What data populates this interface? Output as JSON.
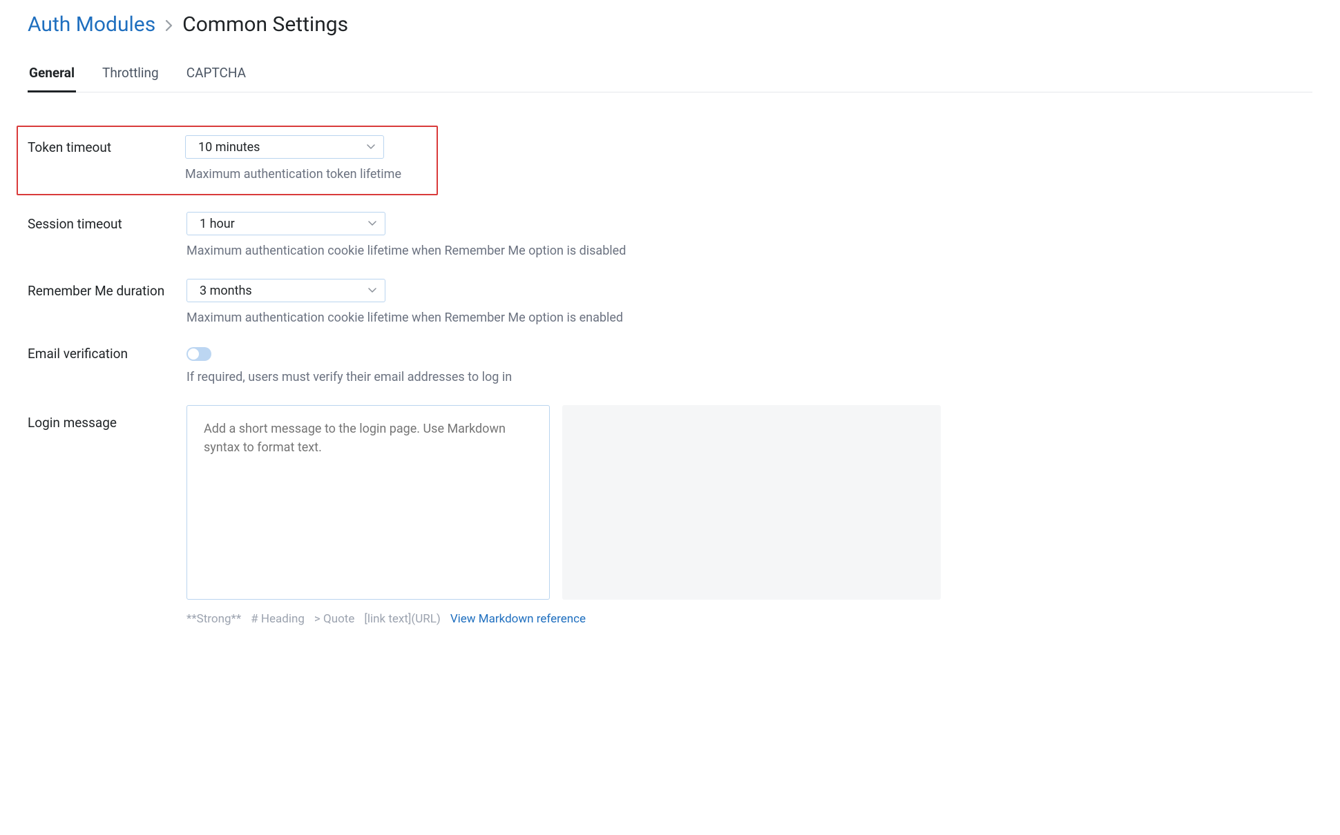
{
  "breadcrumb": {
    "parent": "Auth Modules",
    "current": "Common Settings"
  },
  "tabs": [
    {
      "label": "General",
      "active": true
    },
    {
      "label": "Throttling",
      "active": false
    },
    {
      "label": "CAPTCHA",
      "active": false
    }
  ],
  "token_timeout": {
    "label": "Token timeout",
    "value": "10 minutes",
    "help": "Maximum authentication token lifetime"
  },
  "session_timeout": {
    "label": "Session timeout",
    "value": "1 hour",
    "help": "Maximum authentication cookie lifetime when Remember Me option is disabled"
  },
  "remember_me": {
    "label": "Remember Me duration",
    "value": "3 months",
    "help": "Maximum authentication cookie lifetime when Remember Me option is enabled"
  },
  "email_verification": {
    "label": "Email verification",
    "help": "If required, users must verify their email addresses to log in"
  },
  "login_message": {
    "label": "Login message",
    "placeholder": "Add a short message to the login page. Use Markdown syntax to format text."
  },
  "markdown_hint": {
    "strong": "**Strong**",
    "heading": "# Heading",
    "quote": "> Quote",
    "link": "[link text](URL)",
    "ref": "View Markdown reference"
  }
}
